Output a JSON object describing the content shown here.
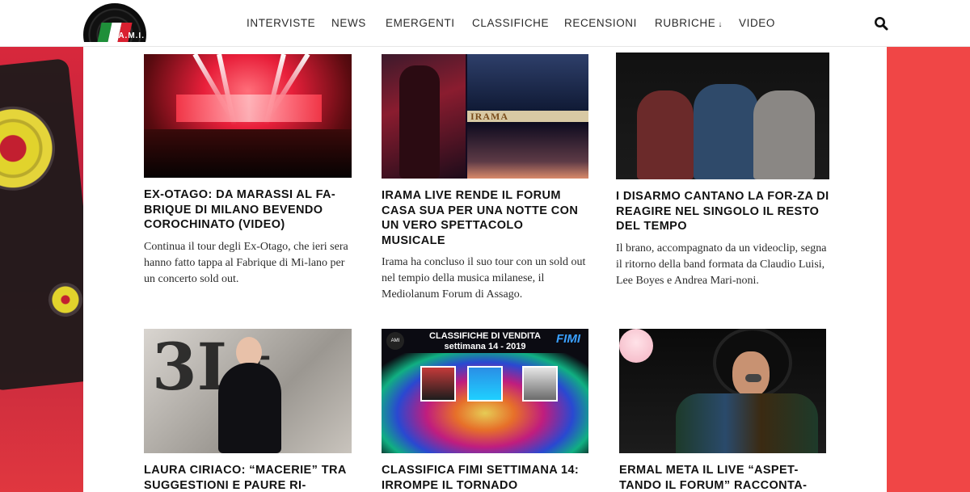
{
  "site": {
    "logo_text": "A.M.I."
  },
  "nav": {
    "items": [
      "INTERVISTE",
      "NEWS",
      "EMERGENTI",
      "CLASSIFICHE",
      "RECENSIONI",
      "RUBRICHE",
      "VIDEO"
    ],
    "dropdown_indicator": "↓"
  },
  "thumbs": {
    "irama_caption": "IRAMA",
    "fimi_header_line1": "CLASSIFICHE DI VENDITA",
    "fimi_header_line2": "settimana 14 - 2019",
    "fimi_logo": "FIMI",
    "fimi_corner_logo": "AMI",
    "laura_graffiti": "3Lt"
  },
  "articles": [
    {
      "title": "EX-OTAGO: DA MARASSI AL FA-BRIQUE DI MILANO BEVENDO COROCHINATO (VIDEO)",
      "excerpt": "Continua il tour degli Ex-Otago, che ieri sera hanno fatto tappa al Fabrique di Mi-lano per un concerto sold out."
    },
    {
      "title": "IRAMA LIVE RENDE IL FORUM CASA SUA PER UNA NOTTE CON UN VERO SPETTACOLO MUSICALE",
      "excerpt": "Irama ha concluso il suo tour con un sold out nel tempio della musica milanese, il Mediolanum Forum di Assago."
    },
    {
      "title": "I DISARMO CANTANO LA FOR-ZA DI REAGIRE NEL SINGOLO IL RESTO DEL TEMPO",
      "excerpt": "Il brano, accompagnato da un videoclip, segna il ritorno della band formata da Claudio Luisi, Lee Boyes e Andrea Mari-noni."
    },
    {
      "title": "LAURA CIRIACO: “MACERIE” TRA SUGGESTIONI E PAURE RI-"
    },
    {
      "title": "CLASSIFICA FIMI SETTIMANA 14: IRROMPE IL TORNADO"
    },
    {
      "title": "ERMAL META IL LIVE “ASPET-TANDO IL FORUM” RACCONTA-"
    }
  ],
  "colors": {
    "accent_red": "#f04646",
    "text": "#111111"
  }
}
